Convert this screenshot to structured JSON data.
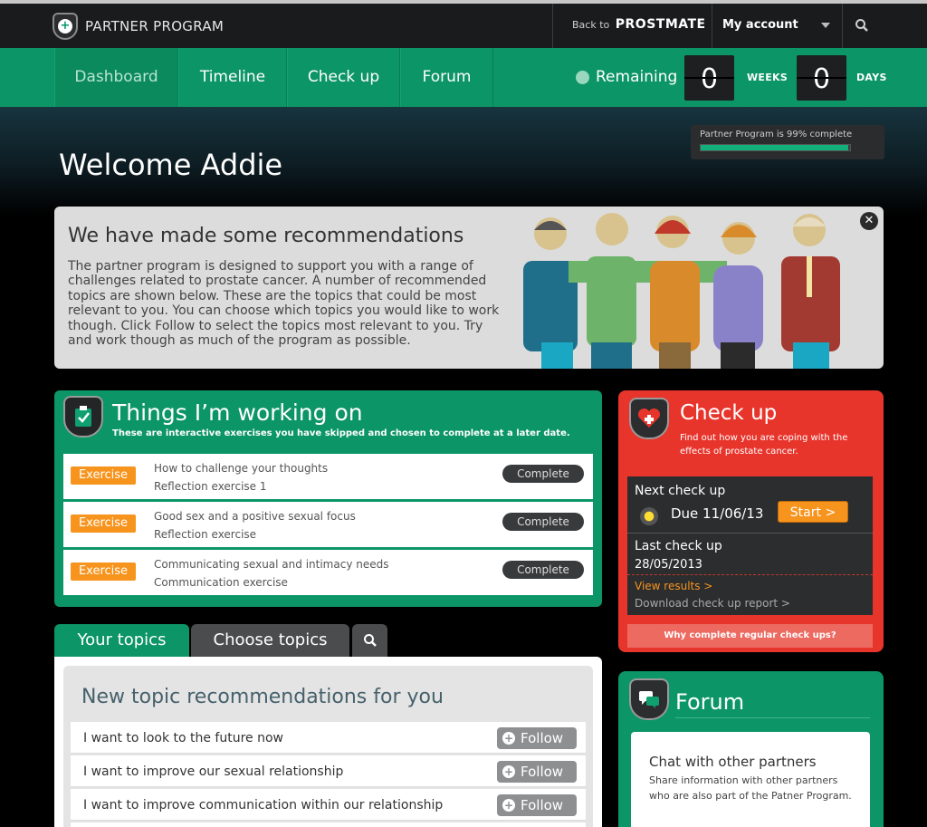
{
  "topbar": {
    "logo_text": "PARTNER PROGRAM",
    "back_prefix": "Back to",
    "back_brand": "PROSTMATE",
    "account_label": "My account"
  },
  "nav": {
    "items": [
      "Dashboard",
      "Timeline",
      "Check up",
      "Forum"
    ],
    "active": "Dashboard",
    "remaining_label": "Remaining",
    "weeks_value": "0",
    "weeks_label": "WEEKS",
    "days_value": "0",
    "days_label": "DAYS"
  },
  "hero": {
    "welcome": "Welcome Addie",
    "progress_text": "Partner Program is 99% complete",
    "progress_fraction": 0.99
  },
  "recommendations": {
    "title": "We have made some recommendations",
    "body": "The partner program is designed to support you with a range of challenges related to prostate cancer. A number of recommended topics are shown below. These are the topics that could be most relevant to you. You can choose which topics you would like to work though. Click Follow to select the topics most relevant to you. Try and work though as much of the program as possible.",
    "close_glyph": "✕"
  },
  "working": {
    "title": "Things I’m working on",
    "subtitle": "These are interactive exercises you have skipped and chosen to complete at a later date.",
    "exercises": [
      {
        "badge": "Exercise",
        "title": "How to challenge your thoughts",
        "sub": "Reflection exercise 1",
        "button": "Complete"
      },
      {
        "badge": "Exercise",
        "title": "Good sex and a positive sexual focus",
        "sub": "Reflection exercise",
        "button": "Complete"
      },
      {
        "badge": "Exercise",
        "title": "Communicating sexual and intimacy needs",
        "sub": "Communication exercise",
        "button": "Complete"
      }
    ]
  },
  "tabs": {
    "your_topics": "Your topics",
    "choose_topics": "Choose topics"
  },
  "topics": {
    "title": "New topic recommendations for you",
    "follow_label": "Follow",
    "items": [
      "I want to look to the future now",
      "I want to improve our sexual relationship",
      "I want to improve communication within our relationship"
    ]
  },
  "checkup": {
    "title": "Check up",
    "subtitle": "Find out how you are coping with the effects of prostate cancer.",
    "next_label": "Next check up",
    "due_text": "Due 11/06/13",
    "start_label": "Start >",
    "last_label": "Last check up",
    "last_date": "28/05/2013",
    "view_results": "View results >",
    "download": "Download check up report >",
    "why": "Why complete regular check ups?"
  },
  "forum": {
    "title": "Forum",
    "chat_title": "Chat with other partners",
    "chat_text": "Share information with other partners who are also part of the Patner Program."
  },
  "colors": {
    "green": "#0c9566",
    "red": "#e8352c",
    "orange": "#f7941d",
    "dark": "#191b1d"
  },
  "icons": [
    "logo-shield-icon",
    "search-icon",
    "caret-down-icon",
    "clock-icon",
    "close-icon",
    "clipboard-check-icon",
    "heart-cross-icon",
    "moon-icon",
    "plus-icon",
    "chat-bubbles-icon"
  ]
}
